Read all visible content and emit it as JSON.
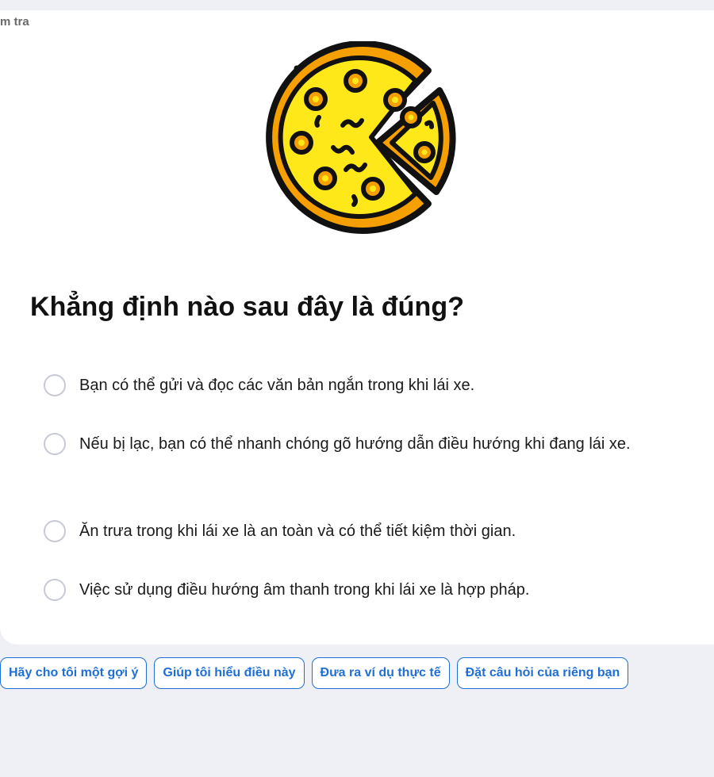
{
  "header": {
    "corner_label": "m tra"
  },
  "illustration": {
    "icon": "pizza-slice-icon",
    "colors": {
      "crust": "#f5a000",
      "cheese": "#ffe81a",
      "outline": "#111111"
    }
  },
  "question": {
    "text": "Khẳng định nào sau đây là đúng?",
    "options": [
      {
        "label": "Bạn có thể gửi và đọc các văn bản ngắn trong khi lái xe.",
        "selected": false
      },
      {
        "label": "Nếu bị lạc, bạn có thể nhanh chóng gõ hướng dẫn điều hướng khi đang lái xe.",
        "selected": false
      },
      {
        "label": "Ăn trưa trong khi lái xe là an toàn và có thể tiết kiệm thời gian.",
        "selected": false
      },
      {
        "label": "Việc sử dụng điều hướng âm thanh trong khi lái xe là hợp pháp.",
        "selected": false
      }
    ]
  },
  "suggestions": [
    {
      "label": "Hãy cho tôi một gợi ý"
    },
    {
      "label": "Giúp tôi hiểu điều này"
    },
    {
      "label": "Đưa ra ví dụ thực tế"
    },
    {
      "label": "Đặt câu hỏi của riêng bạn"
    }
  ],
  "colors": {
    "accent": "#1f6fd6",
    "background": "#eff0f5",
    "radio_border": "#c7c9d6"
  }
}
